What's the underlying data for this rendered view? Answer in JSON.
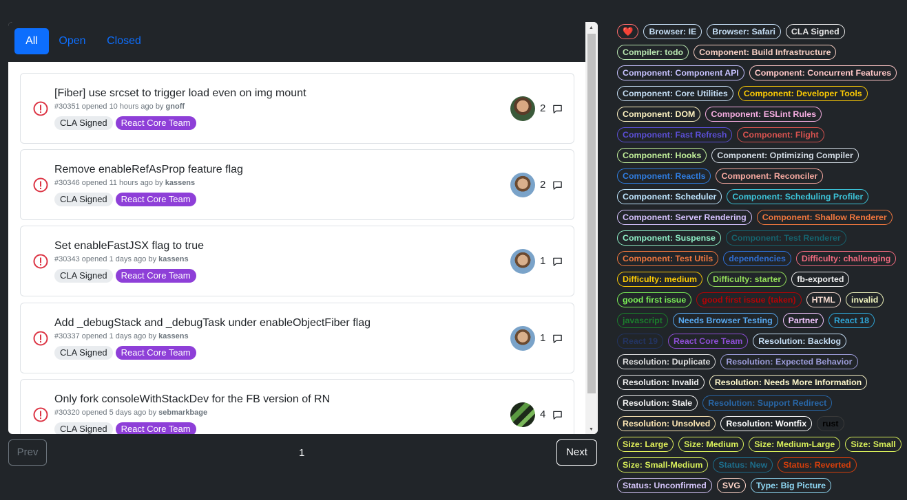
{
  "tabs": [
    {
      "label": "All",
      "active": true
    },
    {
      "label": "Open",
      "active": false
    },
    {
      "label": "Closed",
      "active": false
    }
  ],
  "issues": [
    {
      "title": "[Fiber] use srcset to trigger load even on img mount",
      "number": "#30351",
      "opened_word": "opened",
      "age": "10 hours ago",
      "by_word": "by",
      "author": "gnoff",
      "labels": [
        "CLA Signed",
        "React Core Team"
      ],
      "comments": "2"
    },
    {
      "title": "Remove enableRefAsProp feature flag",
      "number": "#30346",
      "opened_word": "opened",
      "age": "11 hours ago",
      "by_word": "by",
      "author": "kassens",
      "labels": [
        "CLA Signed",
        "React Core Team"
      ],
      "comments": "2"
    },
    {
      "title": "Set enableFastJSX flag to true",
      "number": "#30343",
      "opened_word": "opened",
      "age": "1 days ago",
      "by_word": "by",
      "author": "kassens",
      "labels": [
        "CLA Signed",
        "React Core Team"
      ],
      "comments": "1"
    },
    {
      "title": "Add _debugStack and _debugTask under enableObjectFiber flag",
      "number": "#30337",
      "opened_word": "opened",
      "age": "1 days ago",
      "by_word": "by",
      "author": "kassens",
      "labels": [
        "CLA Signed",
        "React Core Team"
      ],
      "comments": "1"
    },
    {
      "title": "Only fork consoleWithStackDev for the FB version of RN",
      "number": "#30320",
      "opened_word": "opened",
      "age": "5 days ago",
      "by_word": "by",
      "author": "sebmarkbage",
      "labels": [
        "CLA Signed",
        "React Core Team"
      ],
      "comments": "4"
    }
  ],
  "pagination": {
    "prev": "Prev",
    "page": "1",
    "next": "Next"
  },
  "tags": [
    {
      "name": "❤️",
      "color": "#ff6b6b"
    },
    {
      "name": "Browser: IE",
      "color": "#c5def5"
    },
    {
      "name": "Browser: Safari",
      "color": "#c5def5"
    },
    {
      "name": "CLA Signed",
      "color": "#e7e7e7"
    },
    {
      "name": "Compiler: todo",
      "color": "#b8e6b0"
    },
    {
      "name": "Component: Build Infrastructure",
      "color": "#f9d0c4"
    },
    {
      "name": "Component: Component API",
      "color": "#c7c2ff"
    },
    {
      "name": "Component: Concurrent Features",
      "color": "#ffc7c7"
    },
    {
      "name": "Component: Core Utilities",
      "color": "#c5def5"
    },
    {
      "name": "Component: Developer Tools",
      "color": "#fbca04"
    },
    {
      "name": "Component: DOM",
      "color": "#fef2c0"
    },
    {
      "name": "Component: ESLint Rules",
      "color": "#f7aee3"
    },
    {
      "name": "Component: Fast Refresh",
      "color": "#5b4fd6"
    },
    {
      "name": "Component: Flight",
      "color": "#d9534f"
    },
    {
      "name": "Component: Hooks",
      "color": "#c2f09a"
    },
    {
      "name": "Component: Optimizing Compiler",
      "color": "#d4dde6"
    },
    {
      "name": "Component: Reactls",
      "color": "#2f7de1"
    },
    {
      "name": "Component: Reconciler",
      "color": "#f7a9a0"
    },
    {
      "name": "Component: Scheduler",
      "color": "#bfe6ff"
    },
    {
      "name": "Component: Scheduling Profiler",
      "color": "#3cc3d8"
    },
    {
      "name": "Component: Server Rendering",
      "color": "#d6c2ff"
    },
    {
      "name": "Component: Shallow Renderer",
      "color": "#f0773e"
    },
    {
      "name": "Component: Suspense",
      "color": "#8ff0c8"
    },
    {
      "name": "Component: Test Renderer",
      "color": "#16636e"
    },
    {
      "name": "Component: Test Utils",
      "color": "#f0773e"
    },
    {
      "name": "dependencies",
      "color": "#2f6fd6"
    },
    {
      "name": "Difficulty: challenging",
      "color": "#f06a7e"
    },
    {
      "name": "Difficulty: medium",
      "color": "#fbca04"
    },
    {
      "name": "Difficulty: starter",
      "color": "#94e05a"
    },
    {
      "name": "fb-exported",
      "color": "#ededed"
    },
    {
      "name": "good first issue",
      "color": "#7bf057"
    },
    {
      "name": "good first issue (taken)",
      "color": "#b60205"
    },
    {
      "name": "HTML",
      "color": "#f4d8cd"
    },
    {
      "name": "invalid",
      "color": "#f3f7bf"
    },
    {
      "name": "javascript",
      "color": "#1b7d2c"
    },
    {
      "name": "Needs Browser Testing",
      "color": "#57a8f0"
    },
    {
      "name": "Partner",
      "color": "#f2c6ff"
    },
    {
      "name": "React 18",
      "color": "#2fa6d8"
    },
    {
      "name": "React 19",
      "color": "#233461"
    },
    {
      "name": "React Core Team",
      "color": "#8e4ed6"
    },
    {
      "name": "Resolution: Backlog",
      "color": "#c5def5"
    },
    {
      "name": "Resolution: Duplicate",
      "color": "#dedede"
    },
    {
      "name": "Resolution: Expected Behavior",
      "color": "#9c9cd9"
    },
    {
      "name": "Resolution: Invalid",
      "color": "#efefef"
    },
    {
      "name": "Resolution: Needs More Information",
      "color": "#fdf6c9"
    },
    {
      "name": "Resolution: Stale",
      "color": "#f3f3f3"
    },
    {
      "name": "Resolution: Support Redirect",
      "color": "#2866a6"
    },
    {
      "name": "Resolution: Unsolved",
      "color": "#fde7b5"
    },
    {
      "name": "Resolution: Wontfix",
      "color": "#ffffff"
    },
    {
      "name": "rust",
      "color": "#000000"
    },
    {
      "name": "Size: Large",
      "color": "#e4f25a"
    },
    {
      "name": "Size: Medium",
      "color": "#d9f05a"
    },
    {
      "name": "Size: Medium-Large",
      "color": "#d9f05a"
    },
    {
      "name": "Size: Small",
      "color": "#d9f05a"
    },
    {
      "name": "Size: Small-Medium",
      "color": "#d9f05a"
    },
    {
      "name": "Status: New",
      "color": "#1d6e8c"
    },
    {
      "name": "Status: Reverted",
      "color": "#d93f0b"
    },
    {
      "name": "Status: Unconfirmed",
      "color": "#d4c5f9"
    },
    {
      "name": "SVG",
      "color": "#ffd6c9"
    },
    {
      "name": "Type: Big Picture",
      "color": "#8fd8f4"
    }
  ]
}
